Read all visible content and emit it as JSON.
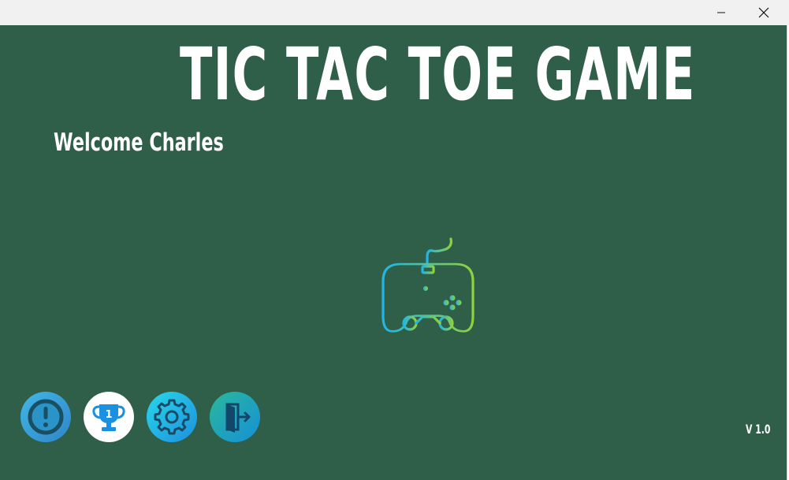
{
  "app": {
    "title": "TIC TAC TOE GAME",
    "welcome": "Welcome Charles",
    "version": "V 1.0"
  },
  "window_controls": {
    "minimize_icon": "minimize-icon",
    "close_icon": "close-icon"
  },
  "center_graphic": {
    "icon": "gamepad-icon",
    "gradient": [
      "#1fb6e8",
      "#8fd13f"
    ]
  },
  "menu_buttons": [
    {
      "id": "info",
      "icon": "exclamation-icon"
    },
    {
      "id": "leaderboard",
      "icon": "trophy-icon",
      "text": "1"
    },
    {
      "id": "settings",
      "icon": "gear-icon"
    },
    {
      "id": "exit",
      "icon": "exit-door-icon"
    }
  ],
  "colors": {
    "background": "#2f5f48",
    "titlebar": "#f1f1f1",
    "text": "#ffffff",
    "accent_blue": "#1e8fdc"
  }
}
